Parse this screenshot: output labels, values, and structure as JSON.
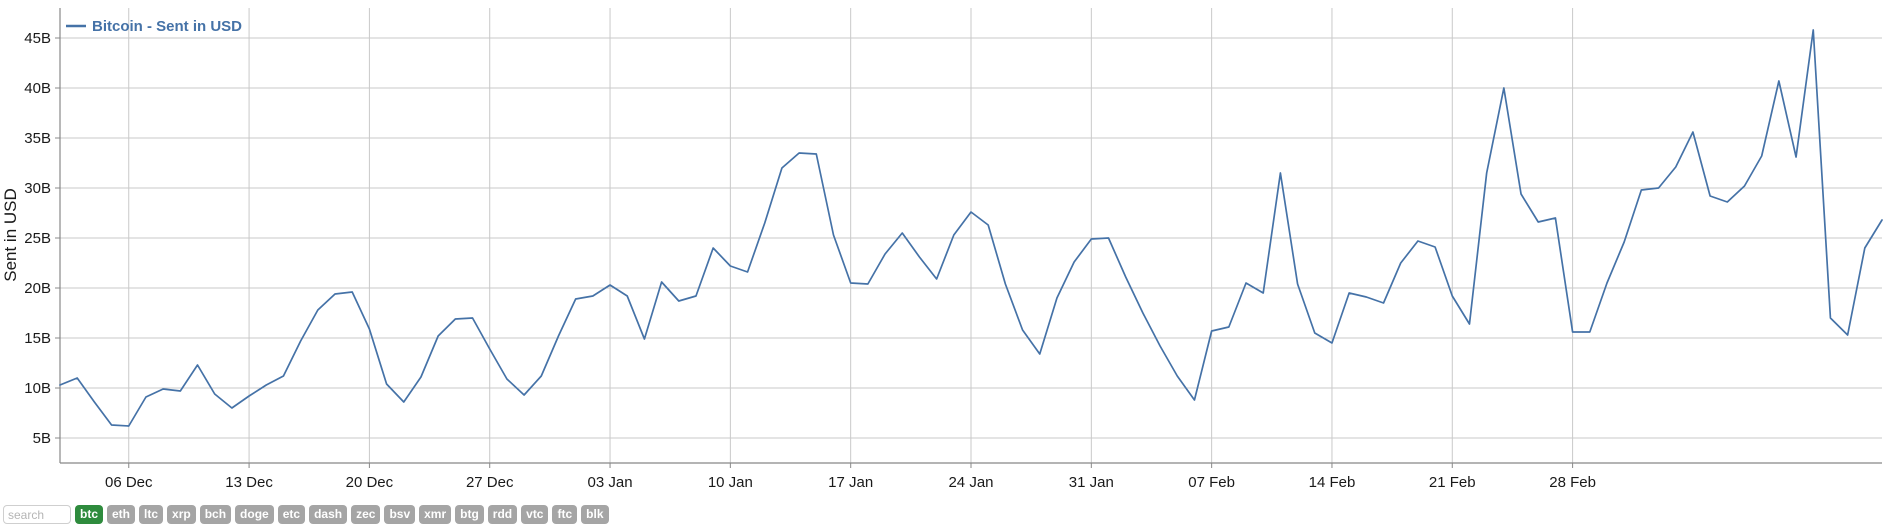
{
  "chart_data": {
    "type": "line",
    "title": "",
    "legend": [
      {
        "label": "Bitcoin - Sent in USD",
        "color": "#4572a7"
      }
    ],
    "legend_position": "top-left",
    "grid": true,
    "xlabel": "",
    "ylabel": "Sent in USD",
    "y_tick_labels": [
      "45B",
      "40B",
      "35B",
      "30B",
      "25B",
      "20B",
      "15B",
      "10B",
      "5B"
    ],
    "y_ticks": [
      45,
      40,
      35,
      30,
      25,
      20,
      15,
      10,
      5
    ],
    "ylim": [
      2.5,
      48
    ],
    "x_tick_labels": [
      "06 Dec",
      "13 Dec",
      "20 Dec",
      "27 Dec",
      "03 Jan",
      "10 Jan",
      "17 Jan",
      "24 Jan",
      "31 Jan",
      "07 Feb",
      "14 Feb",
      "21 Feb",
      "28 Feb"
    ],
    "x_tick_indices": [
      4,
      11,
      18,
      25,
      32,
      39,
      46,
      53,
      60,
      67,
      74,
      81,
      88
    ],
    "series": [
      {
        "name": "Bitcoin - Sent in USD",
        "color": "#4572a7",
        "unit": "B",
        "x": [
          "02 Dec",
          "03 Dec",
          "04 Dec",
          "05 Dec",
          "06 Dec",
          "07 Dec",
          "08 Dec",
          "09 Dec",
          "10 Dec",
          "11 Dec",
          "12 Dec",
          "13 Dec",
          "14 Dec",
          "15 Dec",
          "16 Dec",
          "17 Dec",
          "18 Dec",
          "19 Dec",
          "20 Dec",
          "21 Dec",
          "22 Dec",
          "23 Dec",
          "24 Dec",
          "25 Dec",
          "26 Dec",
          "27 Dec",
          "28 Dec",
          "29 Dec",
          "30 Dec",
          "31 Dec",
          "01 Jan",
          "02 Jan",
          "03 Jan",
          "04 Jan",
          "05 Jan",
          "06 Jan",
          "07 Jan",
          "08 Jan",
          "09 Jan",
          "10 Jan",
          "11 Jan",
          "12 Jan",
          "13 Jan",
          "14 Jan",
          "15 Jan",
          "16 Jan",
          "17 Jan",
          "18 Jan",
          "19 Jan",
          "20 Jan",
          "21 Jan",
          "22 Jan",
          "23 Jan",
          "24 Jan",
          "25 Jan",
          "26 Jan",
          "27 Jan",
          "28 Jan",
          "29 Jan",
          "30 Jan",
          "31 Jan",
          "01 Feb",
          "02 Feb",
          "03 Feb",
          "04 Feb",
          "05 Feb",
          "06 Feb",
          "07 Feb",
          "08 Feb",
          "09 Feb",
          "10 Feb",
          "11 Feb",
          "12 Feb",
          "13 Feb",
          "14 Feb",
          "15 Feb",
          "16 Feb",
          "17 Feb",
          "18 Feb",
          "19 Feb",
          "20 Feb",
          "21 Feb",
          "22 Feb",
          "23 Feb",
          "24 Feb",
          "25 Feb",
          "26 Feb",
          "27 Feb",
          "28 Feb",
          "01 Mar",
          "02 Mar"
        ],
        "values": [
          10.3,
          11.0,
          8.6,
          6.3,
          6.2,
          9.1,
          9.9,
          9.7,
          12.3,
          9.4,
          8.0,
          9.2,
          10.3,
          11.2,
          14.7,
          17.8,
          19.4,
          19.6,
          15.9,
          10.4,
          8.6,
          11.1,
          15.2,
          16.9,
          17.0,
          13.9,
          10.9,
          9.3,
          11.2,
          15.2,
          18.9,
          19.2,
          20.3,
          19.2,
          14.9,
          20.6,
          18.7,
          19.2,
          24.0,
          22.2,
          21.6,
          26.5,
          32.0,
          33.5,
          33.4,
          25.3,
          20.5,
          20.4,
          23.4,
          25.5,
          23.1,
          20.9,
          25.3,
          27.6,
          26.3,
          20.4,
          15.8,
          13.4,
          19.0,
          22.6,
          24.9,
          25.0,
          21.1,
          17.5,
          14.2,
          11.2,
          8.8,
          15.7,
          16.1,
          20.5,
          19.5,
          31.5,
          20.4,
          15.5,
          14.5,
          19.5,
          19.1,
          18.5,
          22.5,
          24.7,
          24.1,
          19.2,
          16.4,
          31.5,
          40.0,
          29.4,
          26.6,
          27.0,
          15.6,
          15.6,
          20.5
        ]
      }
    ],
    "series_continued_note": ""
  },
  "chart_data_tail": {
    "x": [
      "03 Mar",
      "04 Mar",
      "05 Mar",
      "06 Mar",
      "07 Mar",
      "08 Mar",
      "09 Mar",
      "10 Mar",
      "11 Mar",
      "12 Mar",
      "13 Mar",
      "14 Mar",
      "15 Mar",
      "16 Mar",
      "17 Mar",
      "18 Mar"
    ],
    "values": [
      24.6,
      29.8,
      30.0,
      32.1,
      35.6,
      29.2,
      28.6,
      30.2,
      33.2,
      40.7,
      33.1,
      45.8,
      17.0,
      15.3,
      24.0,
      26.8
    ]
  },
  "legend": {
    "series_label": "Bitcoin - Sent in USD",
    "marker_color": "#4572a7"
  },
  "axis": {
    "y_title": "Sent in USD"
  },
  "toolbar": {
    "search_placeholder": "search",
    "search_value": "",
    "active_coin": "btc",
    "coins": [
      {
        "id": "btc",
        "label": "btc",
        "active": true
      },
      {
        "id": "eth",
        "label": "eth",
        "active": false
      },
      {
        "id": "ltc",
        "label": "ltc",
        "active": false
      },
      {
        "id": "xrp",
        "label": "xrp",
        "active": false
      },
      {
        "id": "bch",
        "label": "bch",
        "active": false
      },
      {
        "id": "doge",
        "label": "doge",
        "active": false
      },
      {
        "id": "etc",
        "label": "etc",
        "active": false
      },
      {
        "id": "dash",
        "label": "dash",
        "active": false
      },
      {
        "id": "zec",
        "label": "zec",
        "active": false
      },
      {
        "id": "bsv",
        "label": "bsv",
        "active": false
      },
      {
        "id": "xmr",
        "label": "xmr",
        "active": false
      },
      {
        "id": "btg",
        "label": "btg",
        "active": false
      },
      {
        "id": "rdd",
        "label": "rdd",
        "active": false
      },
      {
        "id": "vtc",
        "label": "vtc",
        "active": false
      },
      {
        "id": "ftc",
        "label": "ftc",
        "active": false
      },
      {
        "id": "blk",
        "label": "blk",
        "active": false
      }
    ],
    "colors": {
      "active_bg": "#2e8b3d",
      "inactive_bg": "#a5a5a5",
      "label_fg": "#ffffff"
    }
  }
}
